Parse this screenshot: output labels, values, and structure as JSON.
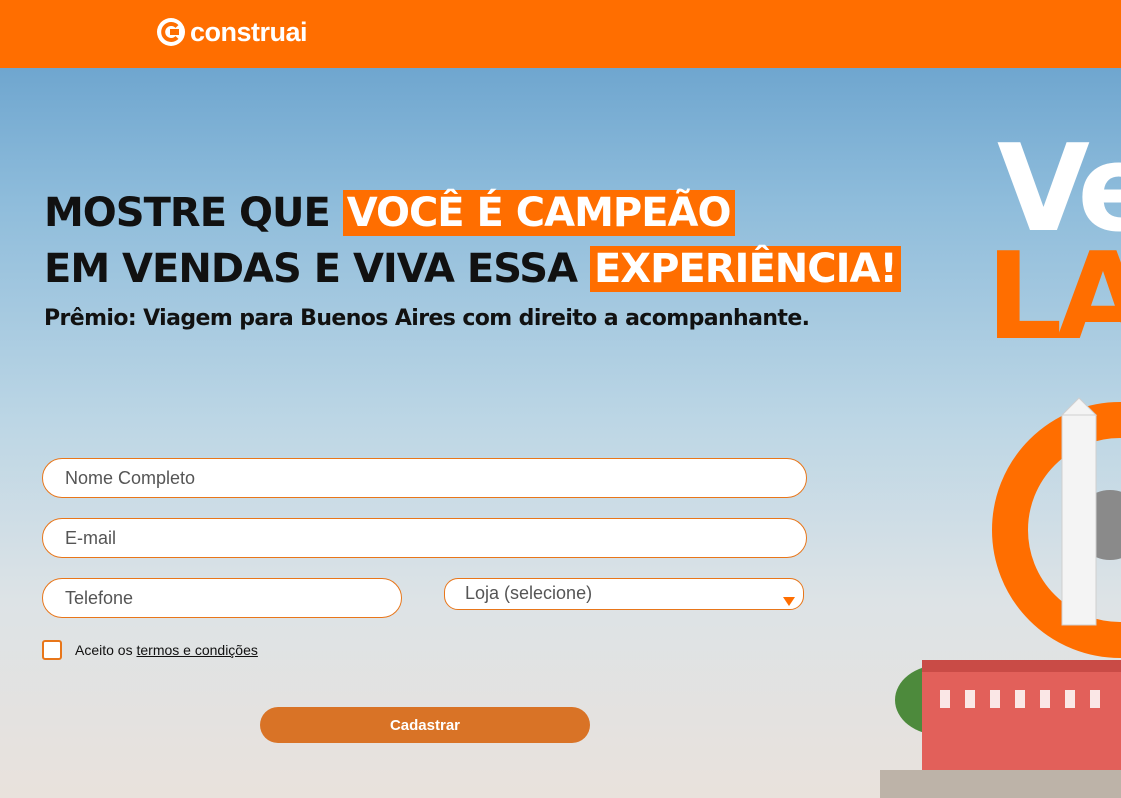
{
  "brand": {
    "name": "construai",
    "color": "#ff6e00"
  },
  "hero": {
    "line1_plain": "MOSTRE QUE ",
    "line1_highlight": "VOCÊ É CAMPEÃO",
    "line2_plain": "EM VENDAS E VIVA ESSA ",
    "line2_highlight": "EXPERIÊNCIA!",
    "subtitle": "Prêmio: Viagem para Buenos Aires com direito a acompanhante."
  },
  "form": {
    "name_placeholder": "Nome Completo",
    "email_placeholder": "E-mail",
    "phone_placeholder": "Telefone",
    "store_selected": "Loja (selecione)",
    "terms_prefix": "Aceito os ",
    "terms_link": "termos e condições",
    "submit_label": "Cadastrar"
  },
  "art": {
    "text_white": "Ve",
    "text_orange": "LA"
  }
}
